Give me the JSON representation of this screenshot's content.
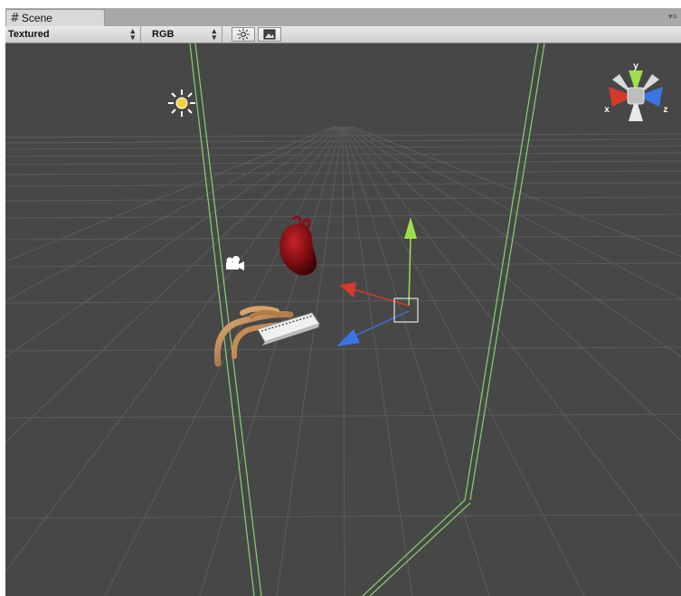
{
  "tab": {
    "title": "Scene",
    "icon": "scene-grid-icon"
  },
  "toolbar": {
    "render_mode": "Textured",
    "color_mode": "RGB",
    "lighting_toggle_icon": "sun-icon",
    "image_toggle_icon": "image-icon"
  },
  "gizmo": {
    "x_label": "x",
    "y_label": "y",
    "z_label": "z"
  },
  "colors": {
    "viewport_bg": "#474747",
    "grid_line": "#5b5b5b",
    "bounds_green": "#86d46a",
    "axis_x": "#d23a2a",
    "axis_y": "#9ee04a",
    "axis_z": "#3a74e0"
  },
  "scene_objects": [
    "directional-light",
    "camera",
    "heart-model",
    "hand-model",
    "ruler-card"
  ]
}
